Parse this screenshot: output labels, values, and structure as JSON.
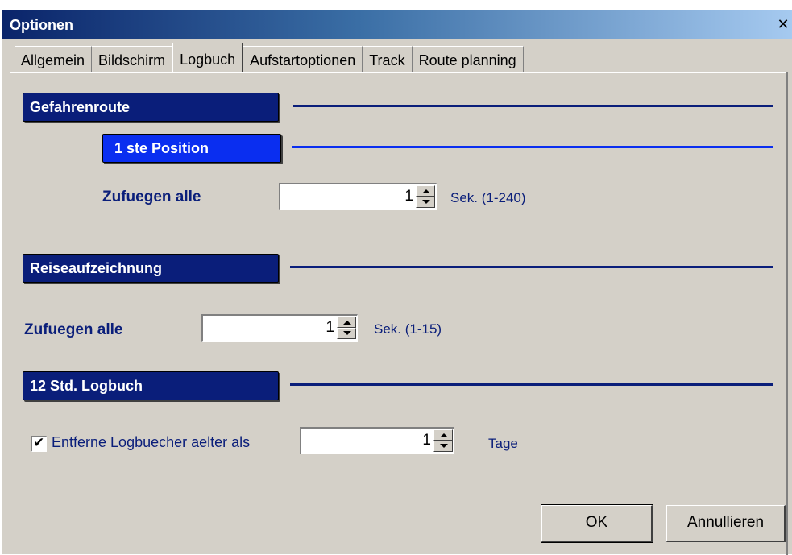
{
  "window": {
    "title": "Optionen",
    "close_symbol": "✕"
  },
  "tabs": [
    {
      "label": "Allgemein",
      "active": false
    },
    {
      "label": "Bildschirm",
      "active": false
    },
    {
      "label": "Logbuch",
      "active": true
    },
    {
      "label": "Aufstartoptionen",
      "active": false
    },
    {
      "label": "Track",
      "active": false
    },
    {
      "label": "Route planning",
      "active": false
    }
  ],
  "sections": {
    "route": {
      "title": "Gefahrenroute",
      "sub_title": "1 ste Position",
      "add_label": "Zufuegen alle",
      "value": "1",
      "unit": "Sek.  (1-240)"
    },
    "travel": {
      "title": "Reiseaufzeichnung",
      "add_label": "Zufuegen alle",
      "value": "1",
      "unit": "Sek. (1-15)"
    },
    "logbook": {
      "title": "12 Std. Logbuch",
      "checkbox_label": "Entferne Logbuecher aelter als",
      "checked": true,
      "value": "1",
      "unit": "Tage"
    }
  },
  "buttons": {
    "ok": "OK",
    "cancel": "Annullieren"
  },
  "colors": {
    "section_dark": "#0a1e7a",
    "section_bright": "#0a2ef0",
    "window_bg": "#d4d0c8"
  }
}
